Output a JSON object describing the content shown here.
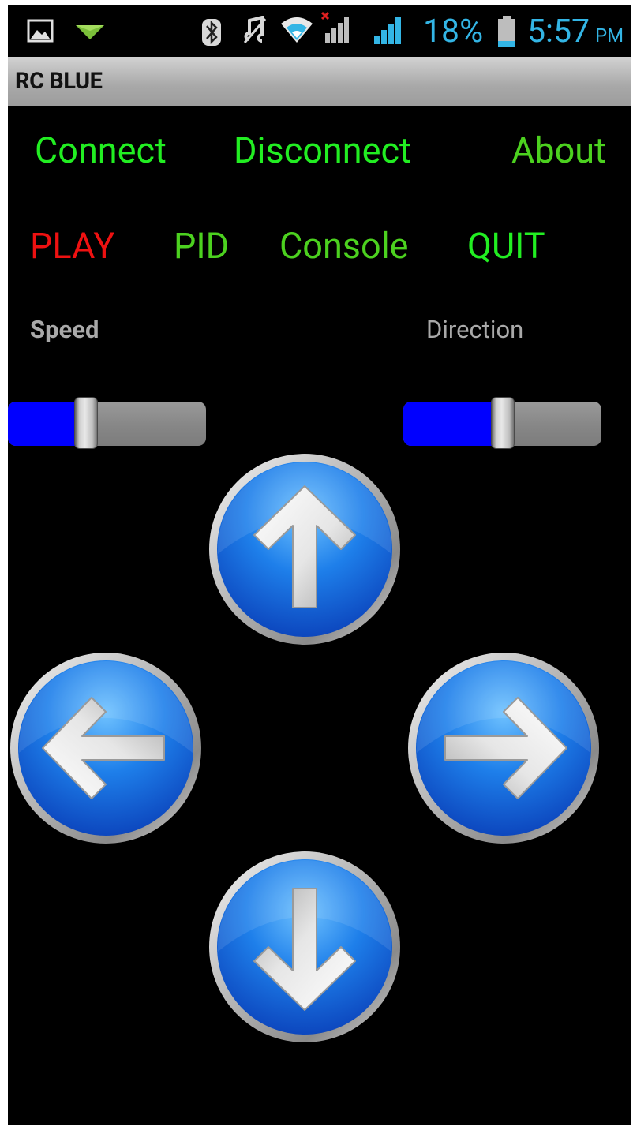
{
  "status_bar": {
    "battery_text": "18%",
    "time": "5:57",
    "ampm": "PM",
    "icons": [
      "image-notification-icon",
      "download-notification-icon",
      "bluetooth-icon",
      "mute-icon",
      "wifi-icon",
      "signal-no-sim-icon",
      "signal-icon",
      "battery-icon"
    ],
    "text_color": "#33b5e5"
  },
  "app": {
    "title": "RC BLUE"
  },
  "menu": {
    "connect": "Connect",
    "disconnect": "Disconnect",
    "about": "About",
    "play": "PLAY",
    "pid": "PID",
    "console": "Console",
    "quit": "QUIT"
  },
  "colors": {
    "green_bright": "#22ee22",
    "green_dim": "#4cd11f",
    "red": "#ee1111",
    "slider_fill": "#0000ff",
    "button_blue": "#1f7fe8"
  },
  "controls": {
    "speed": {
      "label": "Speed",
      "value_fraction": 0.38
    },
    "direction": {
      "label": "Direction",
      "value_fraction": 0.5
    }
  },
  "direction_pad": {
    "buttons": [
      "up-arrow-icon",
      "left-arrow-icon",
      "right-arrow-icon",
      "down-arrow-icon"
    ]
  }
}
